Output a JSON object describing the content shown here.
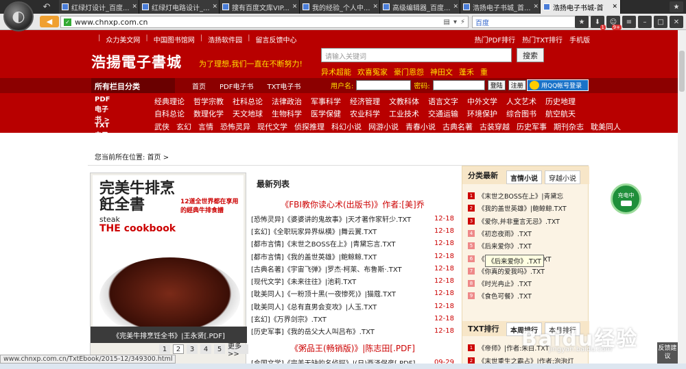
{
  "browser": {
    "tabs": [
      {
        "label": "红绿灯设计_百度..."
      },
      {
        "label": "红绿灯电路设计_..."
      },
      {
        "label": "搜有百度文库VIP..."
      },
      {
        "label": "我的经验_个人中..."
      },
      {
        "label": "高级编辑器_百度..."
      },
      {
        "label": "浩扬电子书城_首..."
      },
      {
        "label": "浩扬电子书城-首"
      }
    ],
    "url": "www.chnxp.com.cn",
    "search_engine": "百度",
    "status_url": "www.chnxp.com.cn/TxtEbook/2015-12/349300.html",
    "badge1": "1",
    "badge2": "9+"
  },
  "header": {
    "top_links": [
      "众力美文网",
      "中国图书馆网",
      "浩扬软件园",
      "留言反馈中心"
    ],
    "right_links": [
      "热门PDF排行",
      "热门TXT排行",
      "手机版"
    ],
    "logo": "浩揚電子書城",
    "slogan": "为了理想,我们一直在不断努力!",
    "search_placeholder": "请输入关键词",
    "search_button": "搜索",
    "hot_words": [
      "异术超能",
      "欢喜冤家",
      "豪门恩怨",
      "神田文",
      "蓬禾",
      "重"
    ],
    "category_label": "所有栏目分类",
    "nav": [
      "首页",
      "PDF电子书",
      "TXT电子书"
    ],
    "username_label": "用户名:",
    "password_label": "密码:",
    "login_button": "登陆",
    "register_button": "注册",
    "qq_login": "用QQ帐号登录"
  },
  "categories": {
    "pdf_label": "PDF电子书 >",
    "pdf_items": [
      "经典理论",
      "哲学宗教",
      "社科总论",
      "法律政治",
      "军事科学",
      "经济管理",
      "文教科体",
      "语言文字",
      "中外文学",
      "人文艺术",
      "历史地理",
      "自科总论",
      "数理化学",
      "天文地球",
      "生物科学",
      "医学保健",
      "农业科学",
      "工业技术",
      "交通运输",
      "环境保护",
      "综合图书",
      "航空航天"
    ],
    "txt_label": "TXT电子书 >",
    "txt_items": [
      "武侠",
      "玄幻",
      "言情",
      "恐怖灵异",
      "现代文学",
      "侦探推理",
      "科幻小说",
      "网游小说",
      "青春小说",
      "古典名著",
      "古装穿越",
      "历史军事",
      "期刊杂志",
      "耽美同人"
    ]
  },
  "breadcrumb": {
    "label": "您当前所在位置:",
    "home": "首页",
    "sep": ">"
  },
  "featured_book": {
    "title": "完美牛排烹飪全書",
    "subtitle": "12道全世界都在享用的經典牛排食譜",
    "en1": "steak",
    "en2": "THE cookbook",
    "caption": "《完美牛排烹饪全书》|王永贤[.PDF]",
    "pages": [
      "1",
      "2",
      "3",
      "4",
      "5",
      "更多>>"
    ],
    "current_page": "2"
  },
  "new_list": {
    "title": "最新列表",
    "feature1": "《FBI教你读心术(出版书)》作者:[美]乔",
    "feature2": "《粥品王(畅销版)》|陈志田[.PDF]",
    "rows": [
      {
        "title": "[恐怖灵异]《婆婆讲的鬼故事》|天才著作家轩少.TXT",
        "date": "12-18"
      },
      {
        "title": "[玄幻]《全职玩家异界纵横》|舞云翼.TXT",
        "date": "12-18"
      },
      {
        "title": "[都市言情]《末世之BOSS在上》|青黛忘言.TXT",
        "date": "12-18"
      },
      {
        "title": "[都市言情]《我的盖世英雄》|鲍鲸鲸.TXT",
        "date": "12-18"
      },
      {
        "title": "[古典名著]《宇宙飞弹》|罗杰·柯莱、布鲁斯·.TXT",
        "date": "12-18"
      },
      {
        "title": "[现代文学]《未来往往》|池莉.TXT",
        "date": "12-18"
      },
      {
        "title": "[耽美同人]《一粉顶十黑(一夜惨死)》|猫蔻.TXT",
        "date": "12-18"
      },
      {
        "title": "[耽美同人]《总有直男会变攻》|人玉.TXT",
        "date": "12-18"
      },
      {
        "title": "[玄幻]《万界剑宗》.TXT",
        "date": "12-18"
      },
      {
        "title": "[历史军事]《我的岳父大人叫吕布》.TXT",
        "date": "12-18"
      }
    ],
    "row_after": {
      "title": "[合国文学]《完美无缺的名侦探》|(日)西泽保彦[.PDF]",
      "date": "09-29"
    }
  },
  "sidebar": {
    "head": "分类最新",
    "tab1": "言情小说",
    "tab2": "穿越小说",
    "items": [
      "《末世之BOSS在上》|青黛忘",
      "《我的盖世英雄》|鲍鲸鲸.TXT",
      "《爱你,并非童言无忌》.TXT",
      "《初恋夜雨》.TXT",
      "《后来爱你》.TXT",
      "《亲自里面的男孩》.TXT",
      "《你真的爱我吗》.TXT",
      "《时光冉止》.TXT",
      "《食色可餐》.TXT"
    ],
    "tooltip": "《后来爱你》.TXT",
    "head2": "TXT排行",
    "tab3": "本周排行",
    "tab4": "本月排行",
    "rank": [
      "《帝师》|作者:朱白.TXT",
      "《末世重生之霸占》|作者:泡泡灯"
    ]
  },
  "overlay": {
    "charging": "充电中",
    "feedback": "反馈建议",
    "watermark": "Baidu经验",
    "watermark_url": "jingyan.baidu.com"
  }
}
